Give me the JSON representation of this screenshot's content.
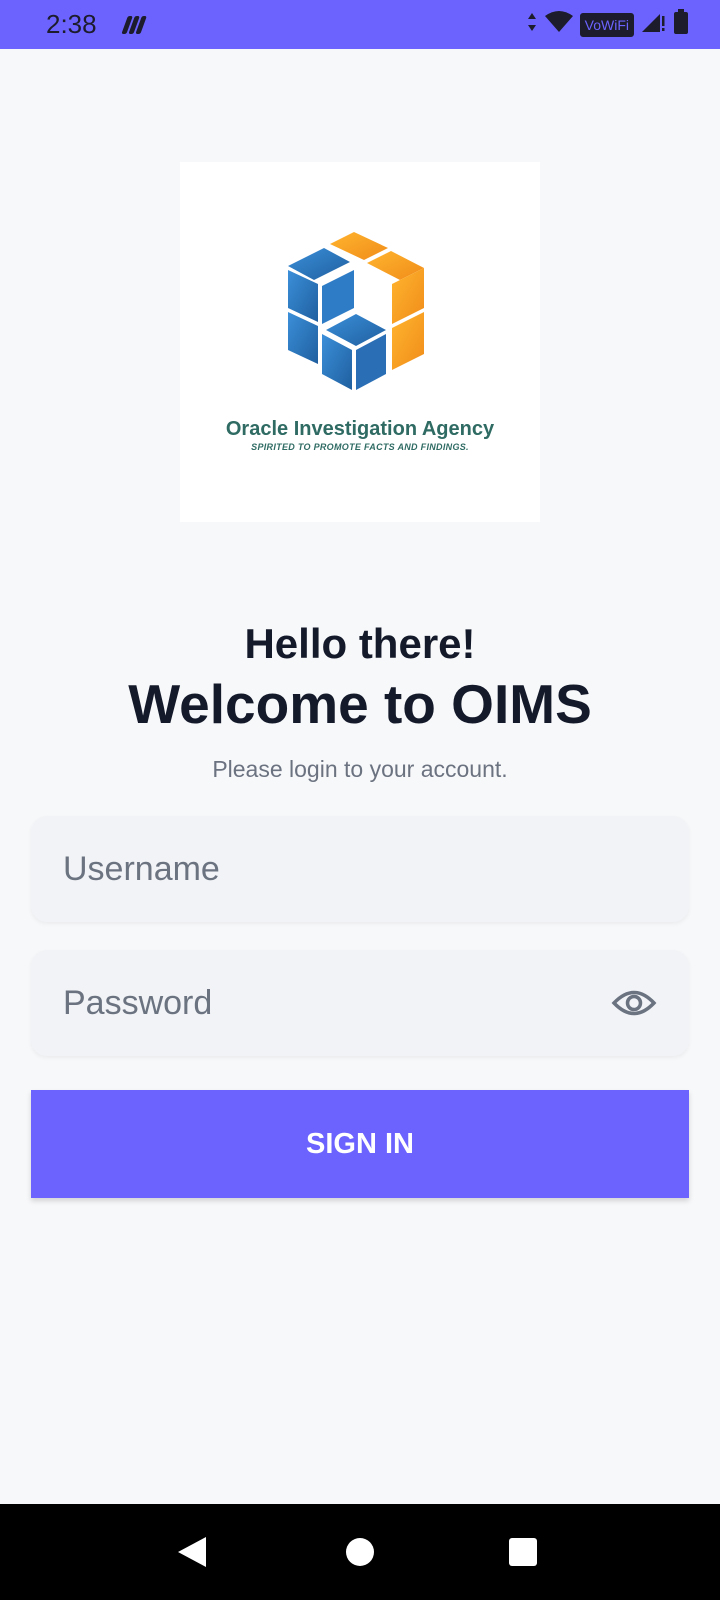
{
  "status_bar": {
    "time": "2:38",
    "icons": [
      "app-icon",
      "data-arrows-icon",
      "wifi-icon",
      "signal-icon",
      "battery-icon"
    ],
    "vowifi_label": "VoWiFi"
  },
  "logo": {
    "name": "Oracle Investigation Agency",
    "tagline": "SPIRITED TO PROMOTE FACTS AND  FINDINGS.",
    "colors": {
      "blue": "#2b7cc4",
      "orange": "#f5a623",
      "text": "#2f6b63"
    }
  },
  "header": {
    "greeting": "Hello there!",
    "welcome": "Welcome to OIMS",
    "subtitle": "Please login to your account."
  },
  "form": {
    "username": {
      "placeholder": "Username",
      "value": ""
    },
    "password": {
      "placeholder": "Password",
      "value": "",
      "toggle_icon": "eye-icon"
    },
    "submit_label": "SIGN IN"
  },
  "nav_bar": {
    "buttons": [
      "back-icon",
      "home-icon",
      "recents-icon"
    ]
  },
  "colors": {
    "accent": "#6c63ff",
    "background": "#f7f8fa",
    "input_bg": "#f1f3f6",
    "heading": "#141a2a",
    "muted": "#6b7280"
  }
}
